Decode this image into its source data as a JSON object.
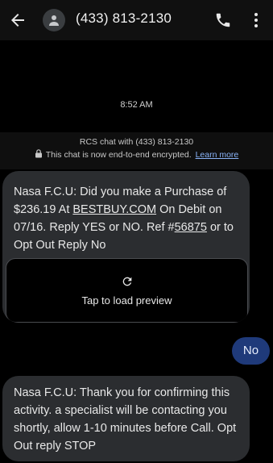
{
  "header": {
    "title": "(433) 813-2130",
    "back_icon": "arrow-back-icon",
    "avatar_icon": "person-icon",
    "call_icon": "phone-icon",
    "more_icon": "more-vert-icon"
  },
  "conversation": {
    "timestamp": "8:52 AM",
    "rcs_line1": "RCS chat with (433) 813-2130",
    "rcs_line2": "This chat is now end-to-end encrypted.",
    "learn_more": "Learn more"
  },
  "messages": [
    {
      "direction": "incoming",
      "parts": {
        "a": "Nasa F.C.U: Did you make a Purchase of $236.19 At ",
        "link1": "BESTBUY.COM",
        "b": " On Debit on 07/16. Reply YES or NO. Ref #",
        "link2": "56875",
        "c": " or to Opt Out Reply No"
      },
      "preview_label": "Tap to load preview"
    },
    {
      "direction": "outgoing",
      "text": "No"
    },
    {
      "direction": "incoming",
      "text": "Nasa F.C.U: Thank you for confirming this activity. a specialist will be contacting you shortly, allow 1-10 minutes before Call. Opt Out reply STOP"
    }
  ],
  "colors": {
    "background": "#000000",
    "incoming_bubble": "#2b2d30",
    "outgoing_bubble": "#1f3a7a",
    "link": "#8ab4f8"
  }
}
